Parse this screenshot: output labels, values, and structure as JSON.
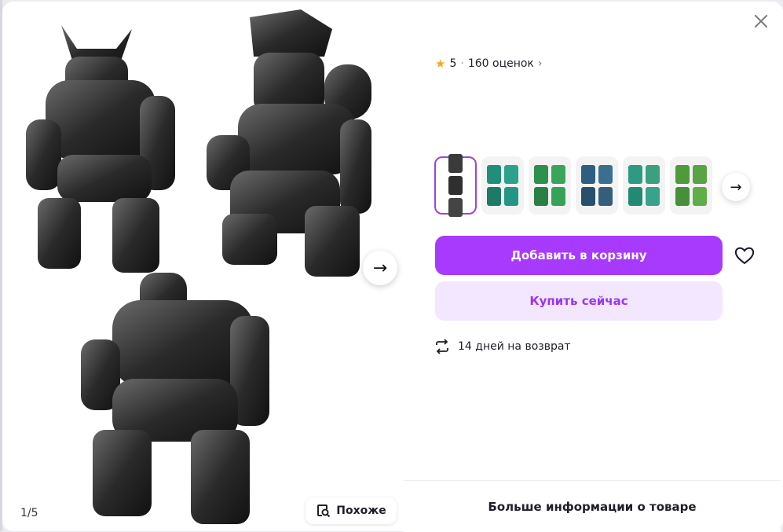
{
  "gallery": {
    "counter": "1/5",
    "similar_label": "Похоже",
    "next_arrow": "→"
  },
  "product": {
    "rating_value": "5",
    "rating_separator": "·",
    "ratings_count": "160 оценок",
    "rating_chevron": "›",
    "star_icon": "★"
  },
  "thumbnails": {
    "items": [
      {
        "colors": [
          "#3a3a3a",
          "#2f2f2f",
          "#444"
        ]
      },
      {
        "colors": [
          "#1f8f7b",
          "#2ba38c",
          "#1c7a67",
          "#249684"
        ]
      },
      {
        "colors": [
          "#2f8f4f",
          "#3aa35c",
          "#2a7f45",
          "#36a158"
        ]
      },
      {
        "colors": [
          "#2f5f7f",
          "#3b6f90",
          "#28506c",
          "#345f7c"
        ]
      },
      {
        "colors": [
          "#2d9a82",
          "#3aa07f",
          "#228a73",
          "#37a38a"
        ]
      },
      {
        "colors": [
          "#4f9a3a",
          "#5aa344",
          "#47903a",
          "#5fae47"
        ]
      }
    ],
    "next_arrow": "→"
  },
  "actions": {
    "add_to_cart": "Добавить в корзину",
    "buy_now": "Купить сейчас"
  },
  "returns": {
    "text": "14 дней на возврат"
  },
  "footer": {
    "more_info": "Больше информации о товаре"
  },
  "colors": {
    "primary": "#a73afd",
    "primary_light": "#f3e6ff",
    "star": "#f5a623"
  }
}
